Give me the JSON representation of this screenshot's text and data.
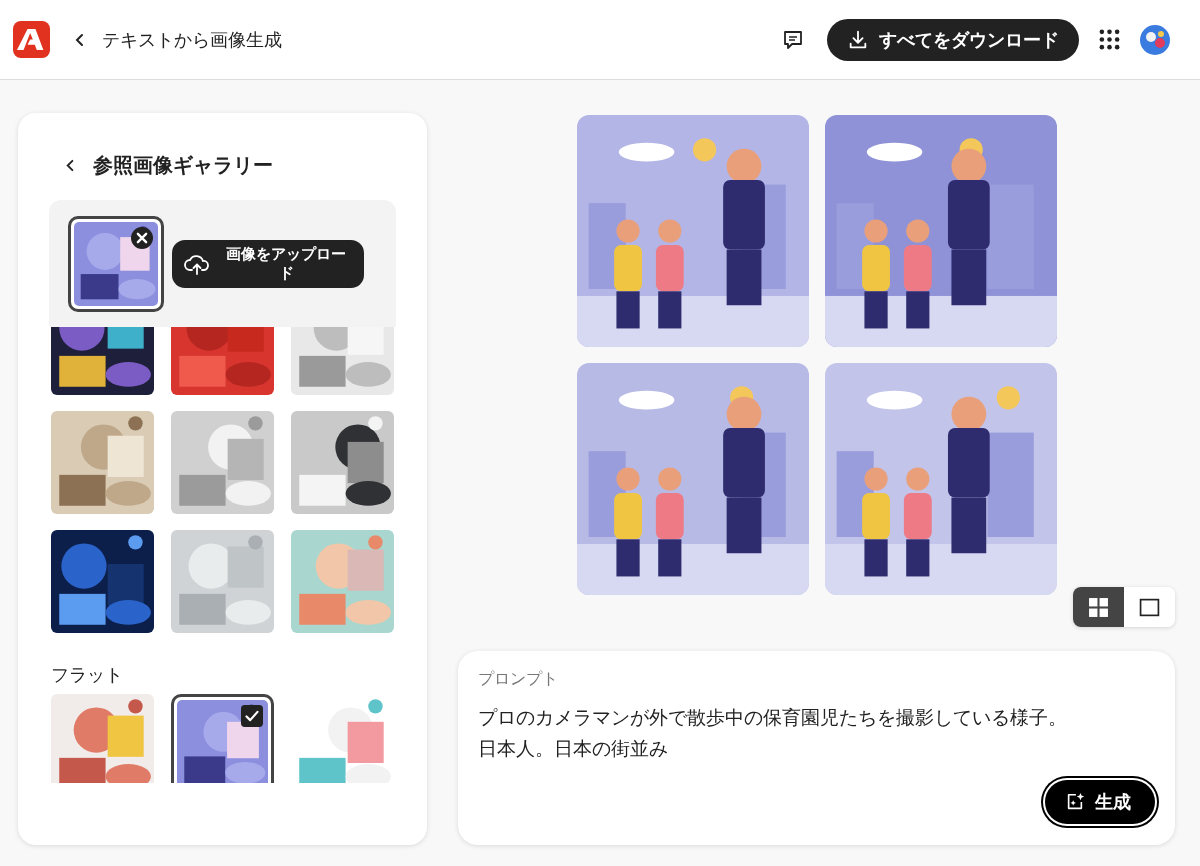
{
  "header": {
    "title": "テキストから画像生成",
    "download_button": "すべてをダウンロード"
  },
  "gallery": {
    "title": "参照画像ギャラリー",
    "reference": {
      "kind": "picture"
    },
    "upload_button": "画像をアップロード",
    "thumbnails": [
      {
        "kind": "picture"
      },
      {
        "kind": "picture"
      },
      {
        "kind": "picture"
      },
      {
        "kind": "picture"
      },
      {
        "kind": "picture"
      },
      {
        "kind": "picture"
      },
      {
        "kind": "picture"
      },
      {
        "kind": "picture"
      },
      {
        "kind": "picture"
      }
    ],
    "sections": [
      {
        "title": "フラット",
        "items": [
          {
            "kind": "picture",
            "selected": false
          },
          {
            "kind": "picture",
            "selected": true
          },
          {
            "kind": "picture",
            "selected": false
          }
        ]
      }
    ]
  },
  "results": [
    {
      "kind": "picture"
    },
    {
      "kind": "picture"
    },
    {
      "kind": "picture"
    },
    {
      "kind": "picture"
    }
  ],
  "view_options": [
    {
      "kind": "grid",
      "selected": true
    },
    {
      "kind": "single",
      "selected": false
    }
  ],
  "prompt": {
    "label": "プロンプト",
    "lines": [
      "プロのカメラマンが外で散歩中の保育園児たちを撮影している様子。",
      "日本人。日本の街並み"
    ],
    "generate_button": "生成"
  }
}
